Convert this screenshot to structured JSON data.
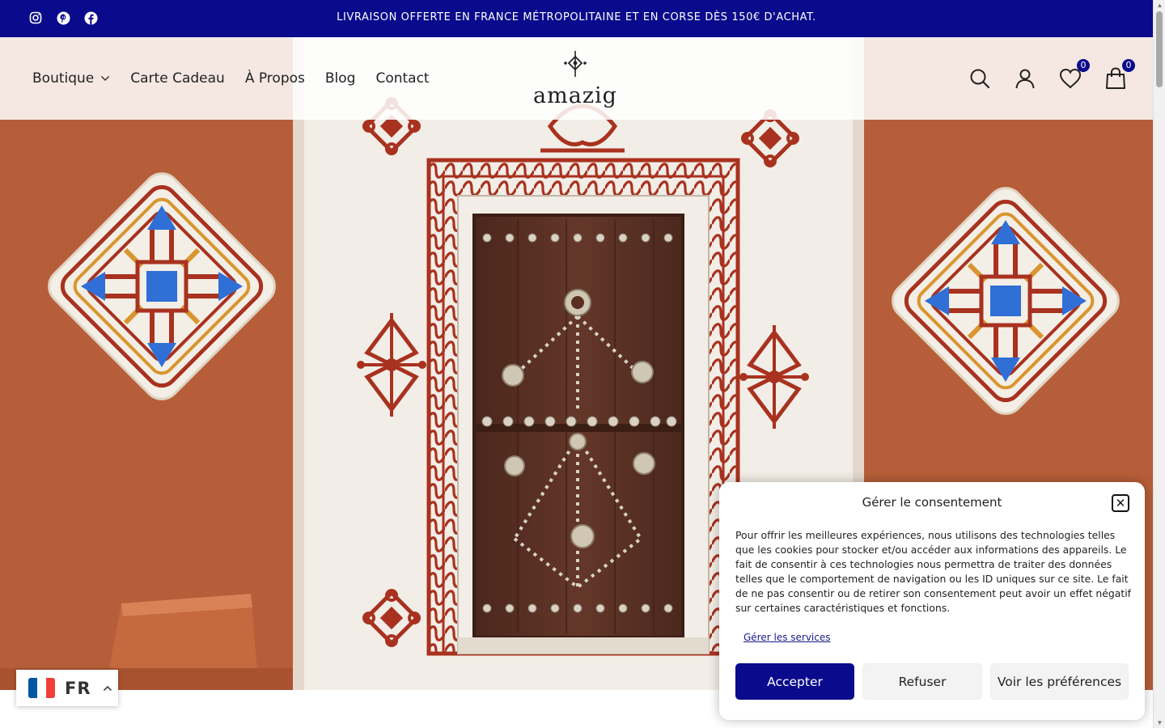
{
  "announcement": "LIVRAISON OFFERTE EN FRANCE MÉTROPOLITAINE ET EN CORSE DÈS 150€ D'ACHAT.",
  "social": [
    {
      "icon": "instagram-icon"
    },
    {
      "icon": "pinterest-icon"
    },
    {
      "icon": "facebook-icon"
    }
  ],
  "nav": {
    "items": [
      {
        "label": "Boutique",
        "has_dropdown": true
      },
      {
        "label": "Carte Cadeau"
      },
      {
        "label": "À Propos"
      },
      {
        "label": "Blog"
      },
      {
        "label": "Contact"
      }
    ]
  },
  "logo": {
    "text": "amazig"
  },
  "header_icons": {
    "wishlist_count": "0",
    "cart_count": "0"
  },
  "language": {
    "code": "FR",
    "flag_colors": [
      "#0055a4",
      "#ffffff",
      "#ef4135"
    ]
  },
  "consent": {
    "title": "Gérer le consentement",
    "body": "Pour offrir les meilleures expériences, nous utilisons des technologies telles que les cookies pour stocker et/ou accéder aux informations des appareils. Le fait de consentir à ces technologies nous permettra de traiter des données telles que le comportement de navigation ou les ID uniques sur ce site. Le fait de ne pas consentir ou de retirer son consentement peut avoir un effet négatif sur certaines caractéristiques et fonctions.",
    "manage_link": "Gérer les services",
    "accept_label": "Accepter",
    "deny_label": "Refuser",
    "prefs_label": "Voir les préférences"
  },
  "colors": {
    "brand": "#0a0a8c",
    "wall": "#b35a36",
    "door": "#5a2f21",
    "motif_red": "#a8321f",
    "motif_blue": "#2f6fd6"
  }
}
